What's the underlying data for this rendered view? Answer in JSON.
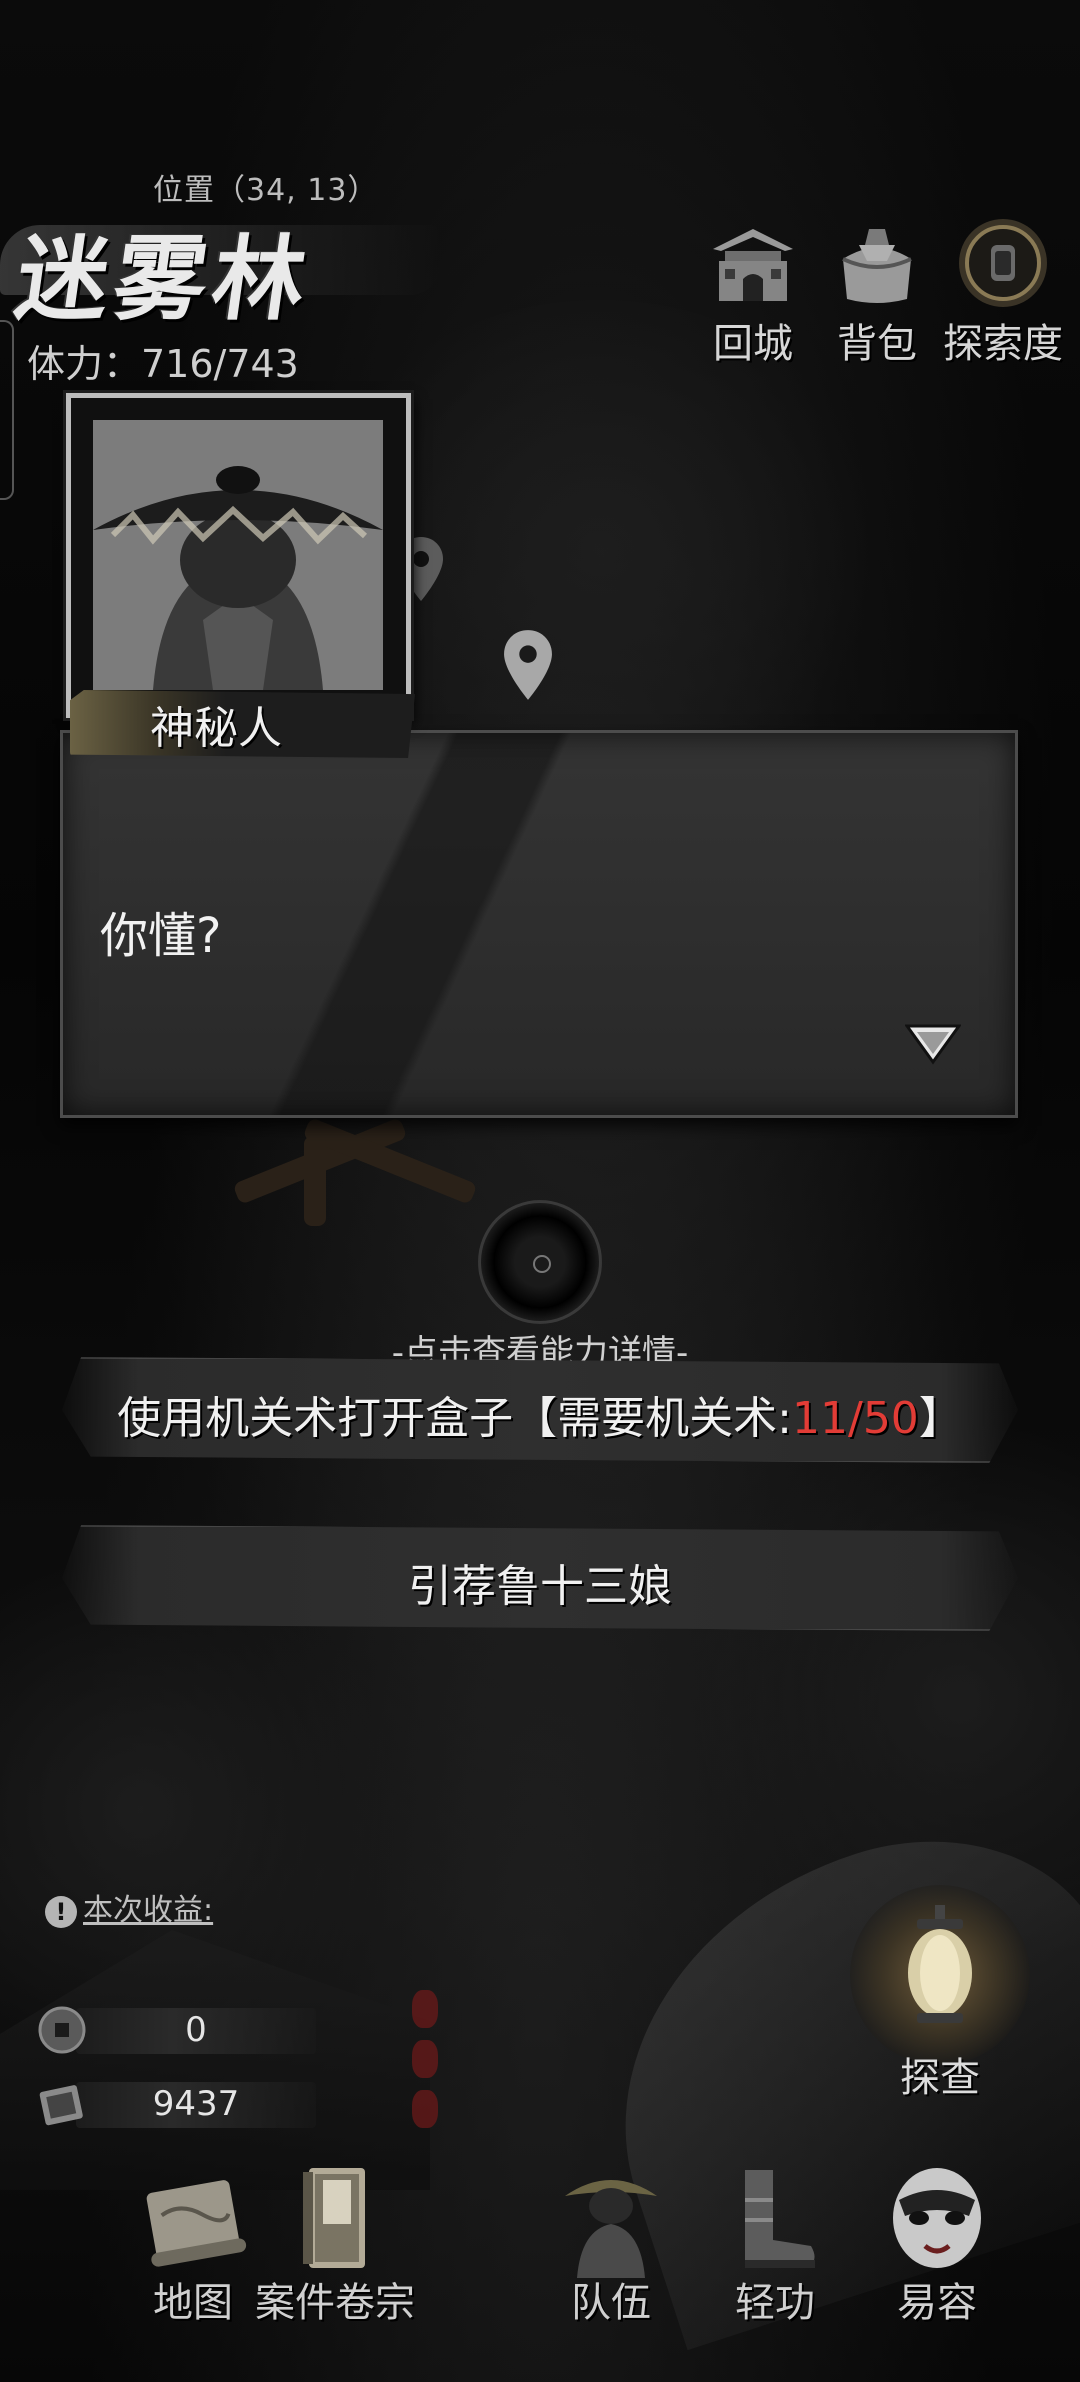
{
  "header": {
    "coords": "位置（34, 13）",
    "location_name": "迷雾林",
    "stamina": "体力：716/743"
  },
  "top_buttons": [
    {
      "label": "回城",
      "icon": "city-gate-icon"
    },
    {
      "label": "背包",
      "icon": "bundle-bag-icon"
    },
    {
      "label": "探索度",
      "icon": "exploration-badge-icon"
    }
  ],
  "dialog": {
    "speaker": "神秘人",
    "text": "你懂?",
    "portrait_icon": "straw-hat-man-portrait"
  },
  "options": {
    "hint": "-点击查看能力详情-",
    "option1": {
      "prefix": "使用机关术打开盒子【需要机关术:",
      "requirement": "11/50",
      "suffix": "】"
    },
    "option2": {
      "label": "引荐鲁十三娘"
    }
  },
  "earnings": {
    "title": "本次收益:",
    "coins": "0",
    "notes": "9437"
  },
  "probe": {
    "label": "探查"
  },
  "bottom_nav": [
    {
      "label": "地图",
      "icon": "map-scroll-icon"
    },
    {
      "label": "案件卷宗",
      "icon": "case-file-icon"
    },
    {
      "label": "队伍",
      "icon": "team-icon"
    },
    {
      "label": "轻功",
      "icon": "boots-icon"
    },
    {
      "label": "易容",
      "icon": "mask-icon"
    }
  ],
  "colors": {
    "requirement_red": "#e23c36",
    "background": "#070707"
  }
}
